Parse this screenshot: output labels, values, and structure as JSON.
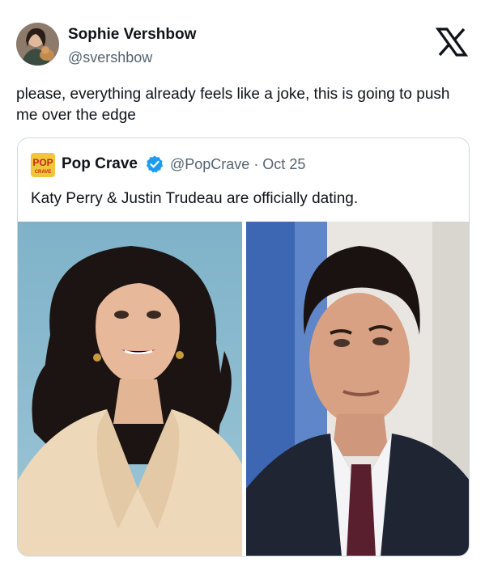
{
  "tweet": {
    "author_name": "Sophie Vershbow",
    "author_handle": "@svershbow",
    "text": "please, everything already feels like a joke, this is going to push me over the edge"
  },
  "quoted": {
    "logo_text_top": "POP",
    "logo_text_bottom": "CRAVE",
    "author_name": "Pop Crave",
    "author_handle": "@PopCrave · Oct 25",
    "text": "Katy Perry & Justin Trudeau are officially dating."
  },
  "icons": {
    "platform": "x-logo-icon",
    "verified": "verified-badge-icon"
  },
  "colors": {
    "text_primary": "#0f1419",
    "text_secondary": "#536471",
    "verified_blue": "#1d9bf0",
    "border": "#cfd9de"
  }
}
